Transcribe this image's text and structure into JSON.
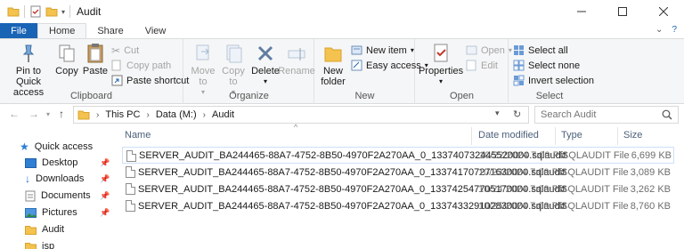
{
  "window": {
    "title": "Audit"
  },
  "tabs": {
    "file": "File",
    "home": "Home",
    "share": "Share",
    "view": "View"
  },
  "ribbon": {
    "clipboard": {
      "label": "Clipboard",
      "pin": "Pin to Quick access",
      "copy": "Copy",
      "paste": "Paste",
      "cut": "Cut",
      "copy_path": "Copy path",
      "paste_shortcut": "Paste shortcut"
    },
    "organize": {
      "label": "Organize",
      "move_to": "Move to",
      "copy_to": "Copy to",
      "delete": "Delete",
      "rename": "Rename"
    },
    "new": {
      "label": "New",
      "new_folder": "New folder",
      "new_item": "New item",
      "easy_access": "Easy access"
    },
    "open": {
      "label": "Open",
      "properties": "Properties",
      "open": "Open",
      "edit": "Edit"
    },
    "select": {
      "label": "Select",
      "select_all": "Select all",
      "select_none": "Select none",
      "invert": "Invert selection"
    }
  },
  "address": {
    "crumbs": [
      "This PC",
      "Data (M:)",
      "Audit"
    ],
    "search_placeholder": "Search Audit"
  },
  "nav_pane": {
    "items": [
      {
        "label": "Quick access",
        "icon": "star-icon"
      },
      {
        "label": "Desktop",
        "icon": "desktop-icon"
      },
      {
        "label": "Downloads",
        "icon": "download-icon"
      },
      {
        "label": "Documents",
        "icon": "documents-icon"
      },
      {
        "label": "Pictures",
        "icon": "pictures-icon"
      },
      {
        "label": "Audit",
        "icon": "folder-icon"
      },
      {
        "label": "isp",
        "icon": "folder-icon"
      }
    ]
  },
  "columns": {
    "name": "Name",
    "date": "Date modified",
    "type": "Type",
    "size": "Size"
  },
  "files": [
    {
      "name": "SERVER_AUDIT_BA244465-88A7-4752-8B50-4970F2A270AA_0_133740732445520000.sqlaudit",
      "date": "10/22/2024 7:00 PM",
      "type": "SQLAUDIT File",
      "size": "6,699 KB"
    },
    {
      "name": "SERVER_AUDIT_BA244465-88A7-4752-8B50-4970F2A270AA_0_133741707271630000.sqlaudit",
      "date": "10/23/2024 7:00 PM",
      "type": "SQLAUDIT File",
      "size": "3,089 KB"
    },
    {
      "name": "SERVER_AUDIT_BA244465-88A7-4752-8B50-4970F2A270AA_0_133742547705170000.sqlaudit",
      "date": "10/24/2024 7:00 PM",
      "type": "SQLAUDIT File",
      "size": "3,262 KB"
    },
    {
      "name": "SERVER_AUDIT_BA244465-88A7-4752-8B50-4970F2A270AA_0_133743329102830000.sqlaudit",
      "date": "10/25/2024 7:00 PM",
      "type": "SQLAUDIT File",
      "size": "8,760 KB"
    }
  ],
  "colors": {
    "accent": "#1a64b5",
    "folder": "#f4c24e"
  }
}
